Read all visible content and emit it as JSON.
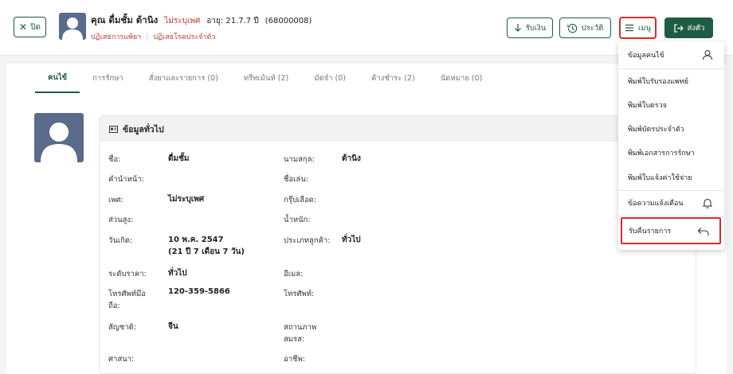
{
  "header": {
    "close_label": "ปิด",
    "patient_name": "คุณ ดื่มชั้ม ต้านิง",
    "gender": "ไม่ระบุเพศ",
    "age": "อายุ: 21.7.7 ปี",
    "hn": "(68000008)",
    "tag_allergy": "ปฏิเสธการแพ้ยา",
    "tag_disease": "ปฏิเสธโรคประจำตัว",
    "pay_label": "รับเงิน",
    "history_label": "ประวัติ",
    "menu_label": "เมนู",
    "send_label": "ส่งตัว"
  },
  "tabs": [
    {
      "label": "คนไข้"
    },
    {
      "label": "การรักษา"
    },
    {
      "label": "สั่งยาและรายการ (0)"
    },
    {
      "label": "ทรีทเม้นท์ (2)"
    },
    {
      "label": "มัดจำ (0)"
    },
    {
      "label": "ค้างชำระ (2)"
    },
    {
      "label": "นัดหมาย (0)"
    }
  ],
  "info": {
    "title": "ข้อมูลทั่วไป",
    "labels": {
      "name": "ชื่อ:",
      "surname": "นามสกุล:",
      "prefix": "คำนำหน้า:",
      "nickname": "ชื่อเล่น:",
      "gender": "เพศ:",
      "blood": "กรุ๊ปเลือด:",
      "height": "ส่วนสูง:",
      "weight": "น้ำหนัก:",
      "birthdate": "วันเกิด:",
      "customer_type": "ประเภทลูกค้า:",
      "price_level": "ระดับราคา:",
      "email": "อีเมล:",
      "mobile_1": "โทรศัพท์มือ",
      "mobile_2": "ถือ:",
      "phone": "โทรศัพท์:",
      "nationality": "สัญชาติ:",
      "marital_1": "สถานภาพ",
      "marital_2": "สมรส:",
      "religion": "ศาสนา:",
      "occupation": "อาชีพ:"
    },
    "values": {
      "name": "ดื่มชั้ม",
      "surname": "ต้านิง",
      "gender": "ไม่ระบุเพศ",
      "birthdate_1": "10 พ.ค. 2547",
      "birthdate_2": "(21 ปี 7 เดือน 7 วัน)",
      "customer_type": "ทั่วไป",
      "price_level": "ทั่วไป",
      "mobile": "120-359-5866",
      "nationality": "จีน"
    }
  },
  "menu": {
    "items": [
      {
        "label": "ข้อมูลคนไข้",
        "icon": "person-icon"
      },
      {
        "label": "พิมพ์ใบรับรองแพทย์"
      },
      {
        "label": "พิมพ์ใบตรวจ"
      },
      {
        "label": "พิมพ์บัตรประจำตัว"
      },
      {
        "label": "พิมพ์เอกสารการรักษา"
      },
      {
        "label": "พิมพ์ใบแจ้งค่าใช้จ่าย"
      },
      {
        "label": "ข้อความแจ้งเตือน",
        "icon": "bell-icon"
      },
      {
        "label": "รับคืนรายการ",
        "icon": "return-arrow-icon"
      }
    ]
  },
  "colors": {
    "primary": "#1e5c44",
    "danger": "#c0392b",
    "highlight": "#d32f2f",
    "avatar_bg": "#5b6b8c"
  }
}
